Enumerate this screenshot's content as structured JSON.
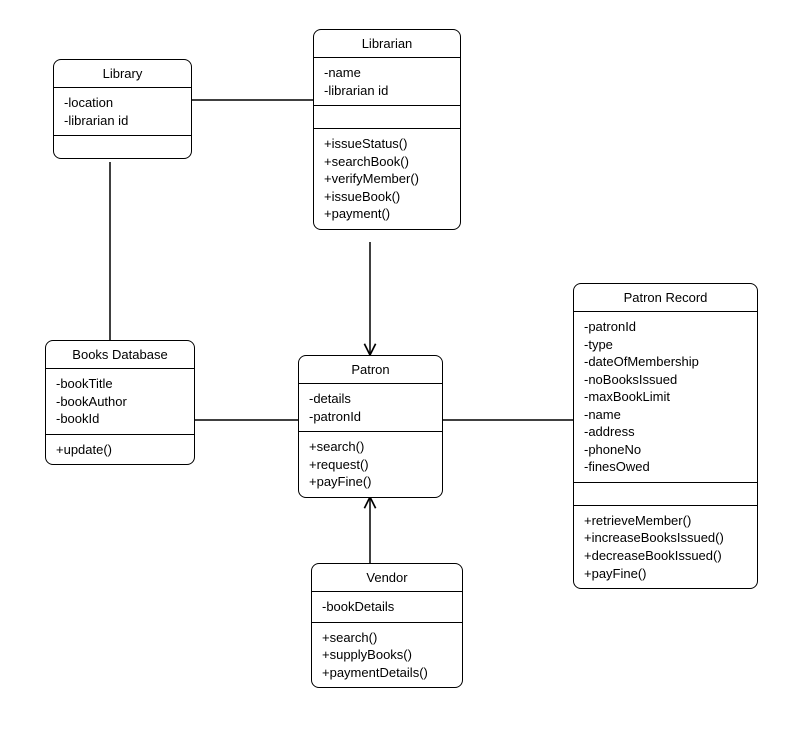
{
  "classes": {
    "library": {
      "name": "Library",
      "attrs": [
        "-location",
        "-librarian id"
      ],
      "ops": []
    },
    "librarian": {
      "name": "Librarian",
      "attrs": [
        "-name",
        "-librarian id"
      ],
      "ops": [
        "+issueStatus()",
        "+searchBook()",
        "+verifyMember()",
        "+issueBook()",
        "+payment()"
      ]
    },
    "booksdb": {
      "name": "Books Database",
      "attrs": [
        "-bookTitle",
        "-bookAuthor",
        "-bookId"
      ],
      "ops": [
        "+update()"
      ]
    },
    "patron": {
      "name": "Patron",
      "attrs": [
        "-details",
        "-patronId"
      ],
      "ops": [
        "+search()",
        "+request()",
        "+payFine()"
      ]
    },
    "patronrecord": {
      "name": "Patron Record",
      "attrs": [
        "-patronId",
        "-type",
        "-dateOfMembership",
        "-noBooksIssued",
        "-maxBookLimit",
        "-name",
        "-address",
        "-phoneNo",
        "-finesOwed"
      ],
      "ops": [
        "+retrieveMember()",
        "+increaseBooksIssued()",
        "+decreaseBookIssued()",
        "+payFine()"
      ]
    },
    "vendor": {
      "name": "Vendor",
      "attrs": [
        "-bookDetails"
      ],
      "ops": [
        "+search()",
        "+supplyBooks()",
        "+paymentDetails()"
      ]
    }
  },
  "chart_data": {
    "type": "uml-class-diagram",
    "classes": [
      {
        "id": "library",
        "name": "Library",
        "attributes": [
          "-location",
          "-librarian id"
        ],
        "operations": []
      },
      {
        "id": "librarian",
        "name": "Librarian",
        "attributes": [
          "-name",
          "-librarian id"
        ],
        "operations": [
          "+issueStatus()",
          "+searchBook()",
          "+verifyMember()",
          "+issueBook()",
          "+payment()"
        ]
      },
      {
        "id": "booksdb",
        "name": "Books Database",
        "attributes": [
          "-bookTitle",
          "-bookAuthor",
          "-bookId"
        ],
        "operations": [
          "+update()"
        ]
      },
      {
        "id": "patron",
        "name": "Patron",
        "attributes": [
          "-details",
          "-patronId"
        ],
        "operations": [
          "+search()",
          "+request()",
          "+payFine()"
        ]
      },
      {
        "id": "patronrecord",
        "name": "Patron Record",
        "attributes": [
          "-patronId",
          "-type",
          "-dateOfMembership",
          "-noBooksIssued",
          "-maxBookLimit",
          "-name",
          "-address",
          "-phoneNo",
          "-finesOwed"
        ],
        "operations": [
          "+retrieveMember()",
          "+increaseBooksIssued()",
          "+decreaseBookIssued()",
          "+payFine()"
        ]
      },
      {
        "id": "vendor",
        "name": "Vendor",
        "attributes": [
          "-bookDetails"
        ],
        "operations": [
          "+search()",
          "+supplyBooks()",
          "+paymentDetails()"
        ]
      }
    ],
    "associations": [
      {
        "from": "library",
        "to": "librarian",
        "directed": false
      },
      {
        "from": "library",
        "to": "booksdb",
        "directed": false
      },
      {
        "from": "librarian",
        "to": "patron",
        "directed": true
      },
      {
        "from": "booksdb",
        "to": "patron",
        "directed": false
      },
      {
        "from": "patron",
        "to": "patronrecord",
        "directed": false
      },
      {
        "from": "vendor",
        "to": "patron",
        "directed": true
      }
    ]
  }
}
